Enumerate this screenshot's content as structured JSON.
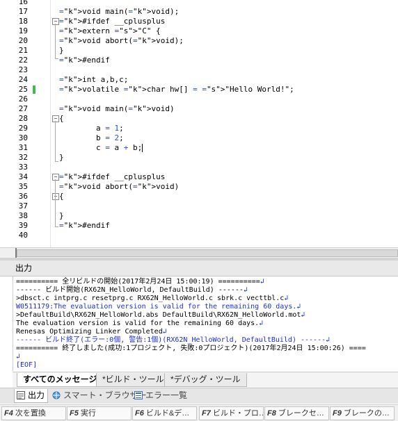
{
  "editor": {
    "lines": [
      {
        "n": "16",
        "code": ""
      },
      {
        "n": "17",
        "code": "void main(void);"
      },
      {
        "n": "18",
        "code": "#ifdef __cplusplus"
      },
      {
        "n": "19",
        "code": "extern \"C\" {"
      },
      {
        "n": "20",
        "code": "void abort(void);"
      },
      {
        "n": "21",
        "code": "}"
      },
      {
        "n": "22",
        "code": "#endif"
      },
      {
        "n": "23",
        "code": ""
      },
      {
        "n": "24",
        "code": "int a,b,c;"
      },
      {
        "n": "25",
        "code": "volatile char hw[] = \"Hello World!\";"
      },
      {
        "n": "26",
        "code": ""
      },
      {
        "n": "27",
        "code": "void main(void)"
      },
      {
        "n": "28",
        "code": "{"
      },
      {
        "n": "29",
        "code": "        a = 1;"
      },
      {
        "n": "30",
        "code": "        b = 2;"
      },
      {
        "n": "31",
        "code": "        c = a + b;"
      },
      {
        "n": "32",
        "code": "}"
      },
      {
        "n": "33",
        "code": ""
      },
      {
        "n": "34",
        "code": "#ifdef __cplusplus"
      },
      {
        "n": "35",
        "code": "void abort(void)"
      },
      {
        "n": "36",
        "code": "{"
      },
      {
        "n": "37",
        "code": ""
      },
      {
        "n": "38",
        "code": "}"
      },
      {
        "n": "39",
        "code": "#endif"
      },
      {
        "n": "40",
        "code": ""
      }
    ]
  },
  "output": {
    "title": "出力",
    "lines": [
      {
        "text": "========== 全リビルドの開始(2017年2月24日 15:00:19) ==========",
        "eol": true,
        "style": "black"
      },
      {
        "text": "------ ビルド開始(RX62N_HelloWorld, DefaultBuild) ------",
        "eol": true,
        "style": "black"
      },
      {
        "text": ">dbsct.c intprg.c resetprg.c RX62N_HelloWorld.c sbrk.c vecttbl.c",
        "eol": true,
        "style": "black"
      },
      {
        "text": "W0511179:The evaluation version is valid for the remaining 60 days.",
        "eol": true,
        "style": "blue"
      },
      {
        "text": ">DefaultBuild\\RX62N_HelloWorld.abs DefaultBuild\\RX62N_HelloWorld.mot",
        "eol": true,
        "style": "black"
      },
      {
        "text": "The evaluation version is valid for the remaining 60 days.",
        "eol": true,
        "style": "black"
      },
      {
        "text": "Renesas Optimizing Linker Completed",
        "eol": true,
        "style": "black"
      },
      {
        "text": "------ ビルド終了(エラー:0個, 警告:1個)(RX62N_HelloWorld, DefaultBuild) ------",
        "eol": true,
        "style": "blue"
      },
      {
        "text": "========== 終了しました(成功:1プロジェクト, 失敗:0プロジェクト)(2017年2月24日 15:00:26) ====",
        "eol": false,
        "style": "black"
      },
      {
        "text": "",
        "eol": true,
        "style": "black"
      },
      {
        "text": "[EOF]",
        "eol": false,
        "style": "blue"
      }
    ]
  },
  "message_tabs": [
    "すべてのメッセージ",
    "*ビルド・ツール",
    "*デバッグ・ツール"
  ],
  "pane_tabs": [
    "出力",
    "スマート・ブラウザー",
    "エラー一覧"
  ],
  "function_keys": [
    {
      "key": "F4",
      "label": "次を置換"
    },
    {
      "key": "F5",
      "label": "実行"
    },
    {
      "key": "F6",
      "label": "ビルド&デ…"
    },
    {
      "key": "F7",
      "label": "ビルド・プロ…"
    },
    {
      "key": "F8",
      "label": "ブレークセ…"
    },
    {
      "key": "F9",
      "label": "ブレークの…"
    }
  ],
  "eol_glyph": "↲"
}
